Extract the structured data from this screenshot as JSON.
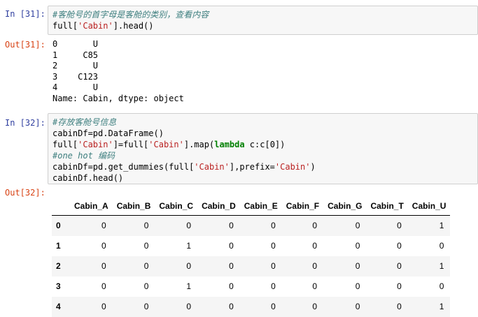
{
  "cells": [
    {
      "in_prompt": "In [31]:",
      "code_lines": [
        {
          "comment": "#客舱号的首字母是客舱的类别，查看内容"
        },
        {
          "pre": "full[",
          "str": "'Cabin'",
          "post": "].head()"
        }
      ],
      "out_prompt": "Out[31]:",
      "output_lines": [
        "0       U",
        "1     C85",
        "2       U",
        "3    C123",
        "4       U",
        "Name: Cabin, dtype: object"
      ]
    },
    {
      "in_prompt": "In [32]:",
      "code": {
        "l1": "#存放客舱号信息",
        "l2": "cabinDf=pd.DataFrame()",
        "l3a": "full[",
        "l3b": "'Cabin'",
        "l3c": "]=full[",
        "l3d": "'Cabin'",
        "l3e": "].map(",
        "l3f": "lambda",
        "l3g": " c:c[0])",
        "l4": "#one hot 编码",
        "l5a": "cabinDf=pd.get_dummies(full[",
        "l5b": "'Cabin'",
        "l5c": "],prefix=",
        "l5d": "'Cabin'",
        "l5e": ")",
        "l6": "cabinDf.head()"
      },
      "out_prompt": "Out[32]:",
      "table": {
        "columns": [
          "",
          "Cabin_A",
          "Cabin_B",
          "Cabin_C",
          "Cabin_D",
          "Cabin_E",
          "Cabin_F",
          "Cabin_G",
          "Cabin_T",
          "Cabin_U"
        ],
        "rows": [
          [
            "0",
            "0",
            "0",
            "0",
            "0",
            "0",
            "0",
            "0",
            "0",
            "1"
          ],
          [
            "1",
            "0",
            "0",
            "1",
            "0",
            "0",
            "0",
            "0",
            "0",
            "0"
          ],
          [
            "2",
            "0",
            "0",
            "0",
            "0",
            "0",
            "0",
            "0",
            "0",
            "1"
          ],
          [
            "3",
            "0",
            "0",
            "1",
            "0",
            "0",
            "0",
            "0",
            "0",
            "0"
          ],
          [
            "4",
            "0",
            "0",
            "0",
            "0",
            "0",
            "0",
            "0",
            "0",
            "1"
          ]
        ]
      }
    }
  ]
}
